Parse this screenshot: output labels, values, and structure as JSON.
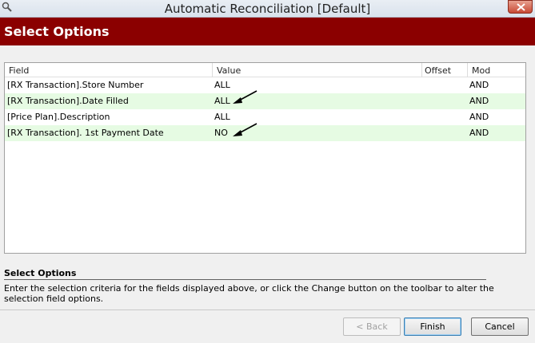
{
  "window": {
    "title": "Automatic Reconciliation [Default]"
  },
  "header": {
    "heading": "Select Options"
  },
  "grid": {
    "columns": {
      "field": "Field",
      "value": "Value",
      "offset": "Offset",
      "mod": "Mod"
    },
    "rows": [
      {
        "field": "[RX Transaction].Store Number",
        "value": "ALL",
        "offset": "",
        "mod": "AND"
      },
      {
        "field": "[RX Transaction].Date Filled",
        "value": "ALL",
        "offset": "",
        "mod": "AND"
      },
      {
        "field": "[Price Plan].Description",
        "value": "ALL",
        "offset": "",
        "mod": "AND"
      },
      {
        "field": "[RX Transaction]. 1st Payment Date",
        "value": "NO",
        "offset": "",
        "mod": "AND"
      }
    ]
  },
  "info": {
    "title": "Select Options",
    "text": "Enter the selection criteria for the fields displayed above, or click the Change button on the toolbar to alter the selection field options."
  },
  "buttons": {
    "back": "< Back",
    "finish": "Finish",
    "cancel": "Cancel"
  },
  "colors": {
    "header_band": "#8b0000",
    "alt_row": "#e6fbe3"
  }
}
